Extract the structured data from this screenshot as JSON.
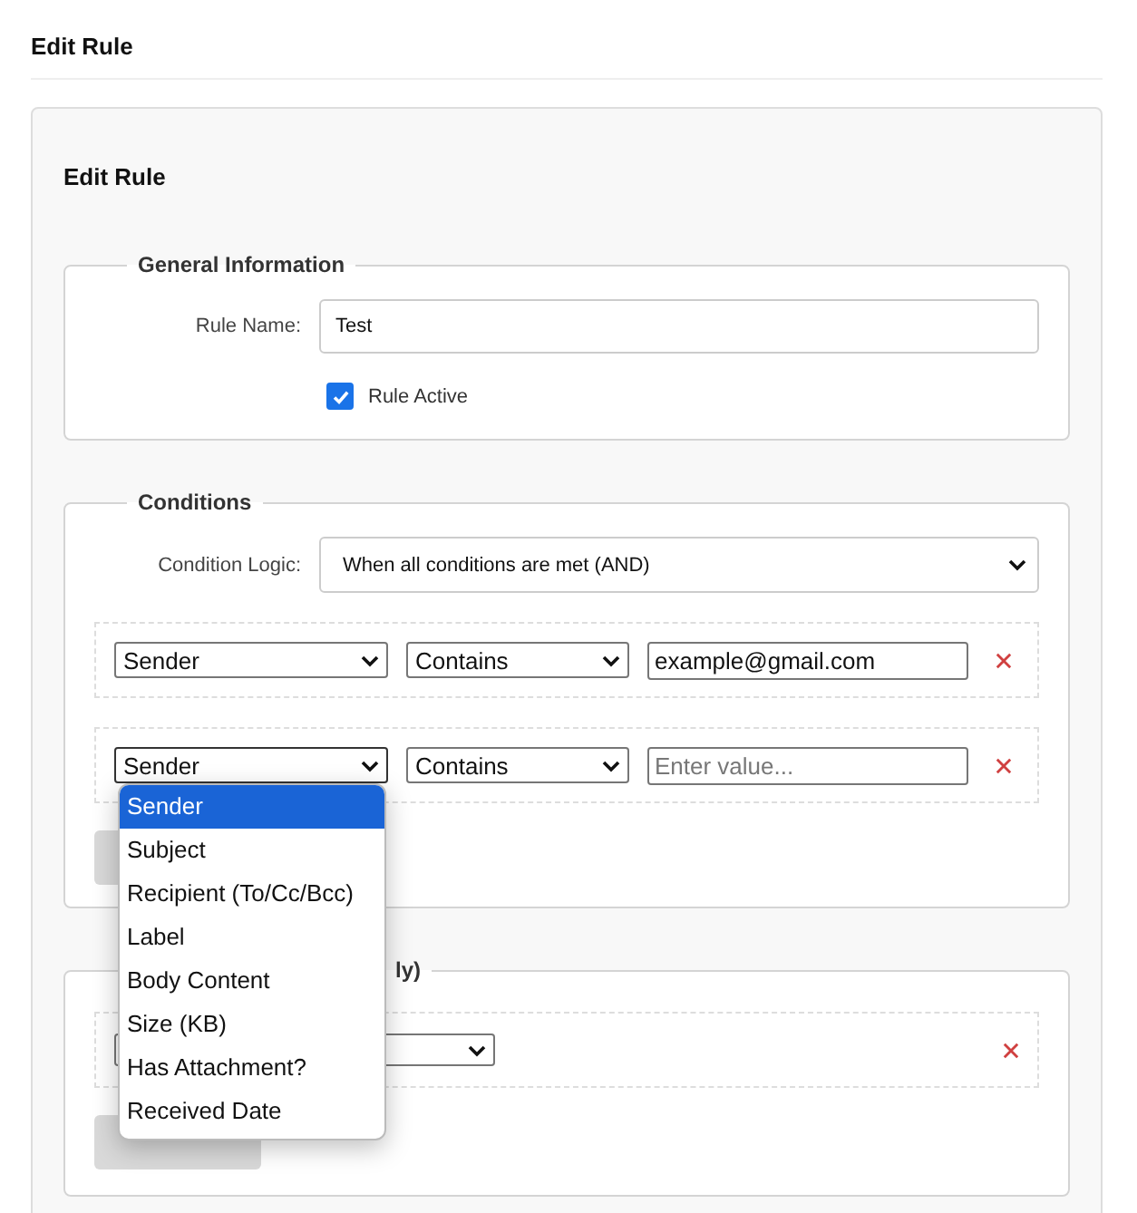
{
  "page_title": "Edit Rule",
  "card_title": "Edit Rule",
  "general": {
    "legend": "General Information",
    "rule_name": {
      "label": "Rule Name:",
      "value": "Test"
    },
    "rule_active": {
      "label": "Rule Active",
      "checked": true
    }
  },
  "conditions": {
    "legend": "Conditions",
    "logic": {
      "label": "Condition Logic:",
      "value": "When all conditions are met (AND)"
    },
    "rows": [
      {
        "field": "Sender",
        "operator": "Contains",
        "value": "example@gmail.com",
        "open": false
      },
      {
        "field": "Sender",
        "operator": "Contains",
        "placeholder": "Enter value...",
        "open": true
      }
    ],
    "field_options": [
      {
        "label": "Sender",
        "selected": true
      },
      {
        "label": "Subject",
        "selected": false
      },
      {
        "label": "Recipient (To/Cc/Bcc)",
        "selected": false
      },
      {
        "label": "Label",
        "selected": false
      },
      {
        "label": "Body Content",
        "selected": false
      },
      {
        "label": "Size (KB)",
        "selected": false
      },
      {
        "label": "Has Attachment?",
        "selected": false
      },
      {
        "label": "Received Date",
        "selected": false
      }
    ]
  },
  "actions": {
    "legend": "ly)"
  }
}
